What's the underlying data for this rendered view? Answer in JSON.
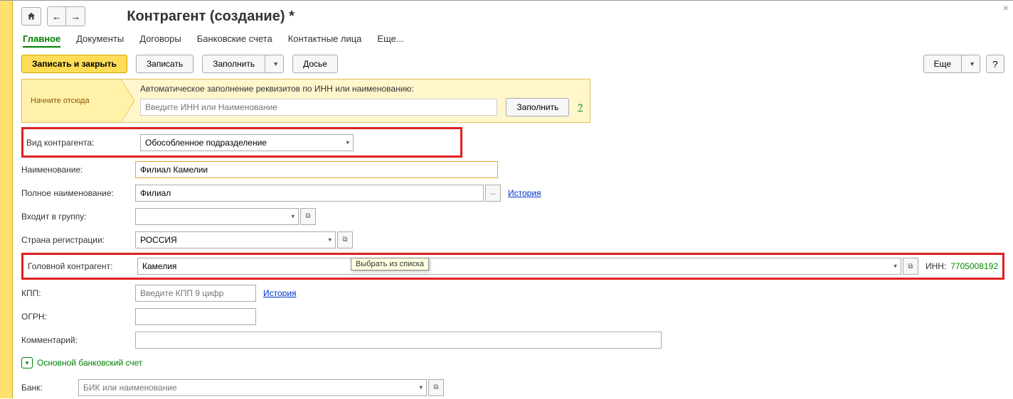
{
  "header": {
    "title": "Контрагент (создание) *"
  },
  "tabs": [
    {
      "label": "Главное",
      "active": true
    },
    {
      "label": "Документы"
    },
    {
      "label": "Договоры"
    },
    {
      "label": "Банковские счета"
    },
    {
      "label": "Контактные лица"
    },
    {
      "label": "Еще..."
    }
  ],
  "toolbar": {
    "save_close": "Записать и закрыть",
    "save": "Записать",
    "fill": "Заполнить",
    "dossier": "Досье",
    "more": "Еще"
  },
  "start": {
    "arrow_label": "Начните отсюда",
    "hint": "Автоматическое заполнение реквизитов по ИНН или наименованию:",
    "placeholder": "Введите ИНН или Наименование",
    "fill_btn": "Заполнить",
    "help": "?"
  },
  "fields": {
    "kind_label": "Вид контрагента:",
    "kind_value": "Обособленное подразделение",
    "name_label": "Наименование:",
    "name_value": "Филиал Камелии",
    "fullname_label": "Полное наименование:",
    "fullname_value": "Филиал",
    "history_link": "История",
    "group_label": "Входит в группу:",
    "group_value": "",
    "country_label": "Страна регистрации:",
    "country_value": "РОССИЯ",
    "head_label": "Головной контрагент:",
    "head_value": "Камелия",
    "head_tooltip": "Выбрать из списка",
    "inn_label": "ИНН:",
    "inn_value": "7705008192",
    "kpp_label": "КПП:",
    "kpp_placeholder": "Введите КПП 9 цифр",
    "ogrn_label": "ОГРН:",
    "comment_label": "Комментарий:"
  },
  "section": {
    "bank_title": "Основной банковский счет",
    "bank_label": "Банк:",
    "bank_placeholder": "БИК или наименование"
  }
}
